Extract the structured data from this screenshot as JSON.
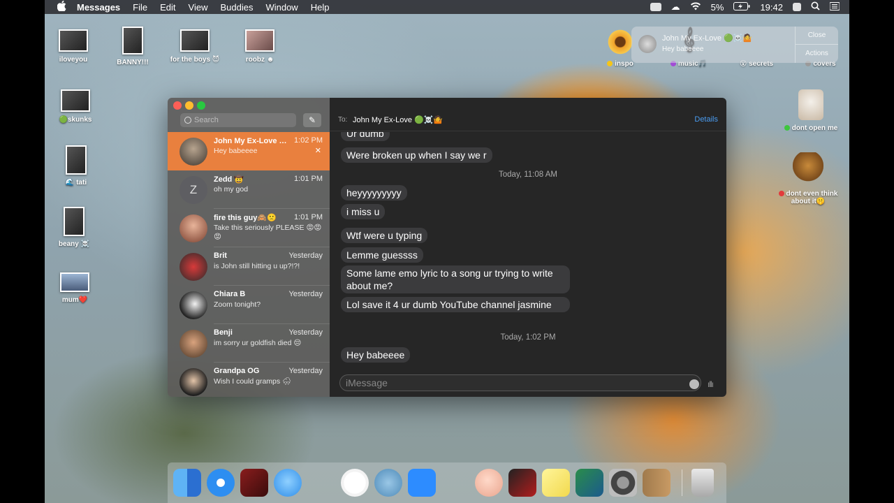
{
  "menubar": {
    "app_name": "Messages",
    "menus": [
      "File",
      "Edit",
      "View",
      "Buddies",
      "Window",
      "Help"
    ],
    "battery": "5%",
    "clock": "19:42"
  },
  "desktop": {
    "icons_left": [
      {
        "label": "iloveyou"
      },
      {
        "label": "BANNY!!!"
      },
      {
        "label": "for the boys 😈"
      },
      {
        "label": "roobz ☻"
      },
      {
        "label": "🟢skunks"
      },
      {
        "label": "🌊 tati"
      },
      {
        "label": "beany ☠️"
      },
      {
        "label": "mum❤️"
      }
    ],
    "icons_right": [
      {
        "label": "inspo",
        "dot": "#f5c518"
      },
      {
        "label": "music🎵",
        "dot": "#a24bd6"
      },
      {
        "label": "😵 secrets",
        "dot": ""
      },
      {
        "label": "covers",
        "dot": "#9a9a9a"
      },
      {
        "label": "dont open me",
        "dot": "#3ec63e"
      },
      {
        "label": "dont even think about it🤫",
        "dot": "#e23b3b"
      }
    ]
  },
  "notification": {
    "title": "John My Ex-Love 🟢☠️🤷",
    "message": "Hey babeeee",
    "close_label": "Close",
    "actions_label": "Actions"
  },
  "sidebar": {
    "search_placeholder": "Search",
    "compose_icon": "✎",
    "conversations": [
      {
        "name": "John My Ex-Love 🟢…",
        "time": "1:02 PM",
        "preview": "Hey babeeee",
        "selected": true
      },
      {
        "name": "Zedd 🤠",
        "time": "1:01 PM",
        "preview": "oh my god",
        "letter": "Z"
      },
      {
        "name": "fire this guy🙈🙁",
        "time": "1:01 PM",
        "preview": "Take this seriously PLEASE 😡😡😡"
      },
      {
        "name": "Brit",
        "time": "Yesterday",
        "preview": "is John still hitting u up?!?!"
      },
      {
        "name": "Chiara B",
        "time": "Yesterday",
        "preview": "Zoom tonight?"
      },
      {
        "name": "Benji",
        "time": "Yesterday",
        "preview": "im sorry ur goldfish died 😔"
      },
      {
        "name": "Grandpa OG",
        "time": "Yesterday",
        "preview": "Wish I could gramps 🌨"
      }
    ]
  },
  "chat": {
    "to_label": "To:",
    "recipient": "John My Ex-Love 🟢☠️🤷",
    "details_label": "Details",
    "partial_message": "Ur dumb",
    "messages": [
      "Were broken up when I say we r",
      "heyyyyyyyyy",
      "i miss u",
      "Wtf were u typing",
      "Lemme guessss",
      "Some lame emo lyric to a song ur trying to write about me?",
      "Lol save it 4 ur dumb YouTube channel jasmine",
      "Hey babeeee"
    ],
    "stamps": [
      "Today, 11:08 AM",
      "Today, 1:02 PM"
    ],
    "input_placeholder": "iMessage"
  },
  "dock": {
    "apps": [
      "finder-icon",
      "safari-icon",
      "photo-booth-icon",
      "messages-icon",
      "mascot-icon",
      "music-icon",
      "seal-icon",
      "zoom-icon",
      "garageband-icon",
      "face-icon",
      "photo-icon",
      "stickies-icon",
      "preview-icon",
      "system-preferences-icon",
      "contacts-icon",
      "trash-icon"
    ]
  }
}
